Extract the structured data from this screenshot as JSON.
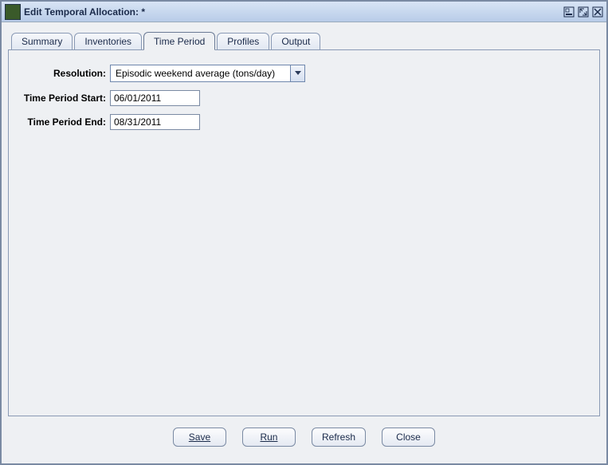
{
  "window": {
    "title": "Edit Temporal Allocation:  *"
  },
  "tabs": {
    "summary": "Summary",
    "inventories": "Inventories",
    "time_period": "Time Period",
    "profiles": "Profiles",
    "output": "Output"
  },
  "form": {
    "resolution_label": "Resolution:",
    "resolution_value": "Episodic weekend average (tons/day)",
    "start_label": "Time Period Start:",
    "start_value": "06/01/2011",
    "end_label": "Time Period End:",
    "end_value": "08/31/2011"
  },
  "buttons": {
    "save": "Save",
    "run": "Run",
    "refresh": "Refresh",
    "close": "Close"
  }
}
